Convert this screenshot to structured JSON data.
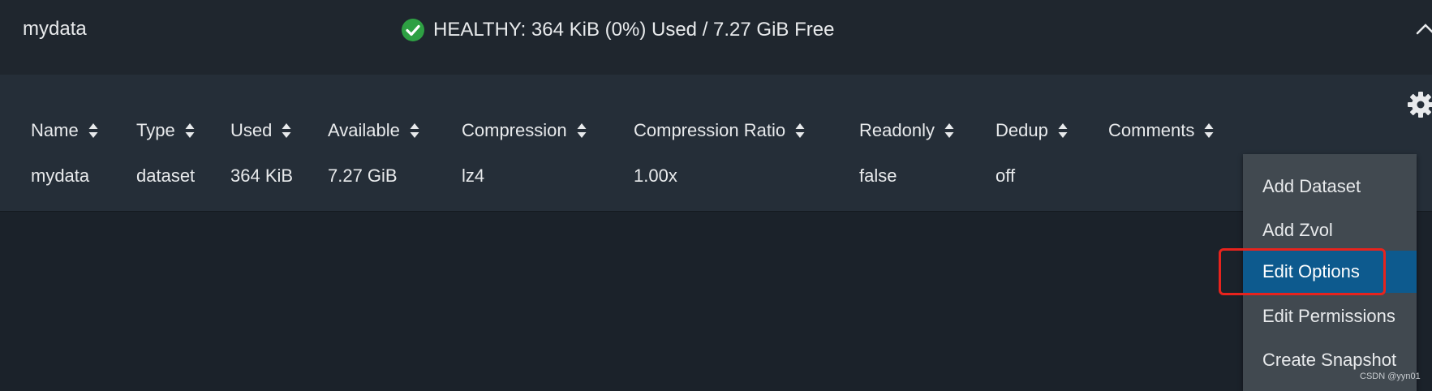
{
  "pool": {
    "name": "mydata",
    "status_text": "HEALTHY: 364 KiB (0%) Used / 7.27 GiB Free",
    "status_icon": "check-circle-icon",
    "status_color": "#2ea043"
  },
  "table": {
    "headers": [
      "Name",
      "Type",
      "Used",
      "Available",
      "Compression",
      "Compression Ratio",
      "Readonly",
      "Dedup",
      "Comments"
    ],
    "rows": [
      [
        "mydata",
        "dataset",
        "364 KiB",
        "7.27 GiB",
        "lz4",
        "1.00x",
        "false",
        "off",
        ""
      ]
    ]
  },
  "menu": {
    "items": [
      "Add Dataset",
      "Add Zvol",
      "Edit Options",
      "Edit Permissions",
      "Create Snapshot"
    ],
    "selected": "Edit Options",
    "accent_color": "#0d5a8e",
    "annotation_color": "#e8231d"
  },
  "watermark": "CSDN @yyn01"
}
